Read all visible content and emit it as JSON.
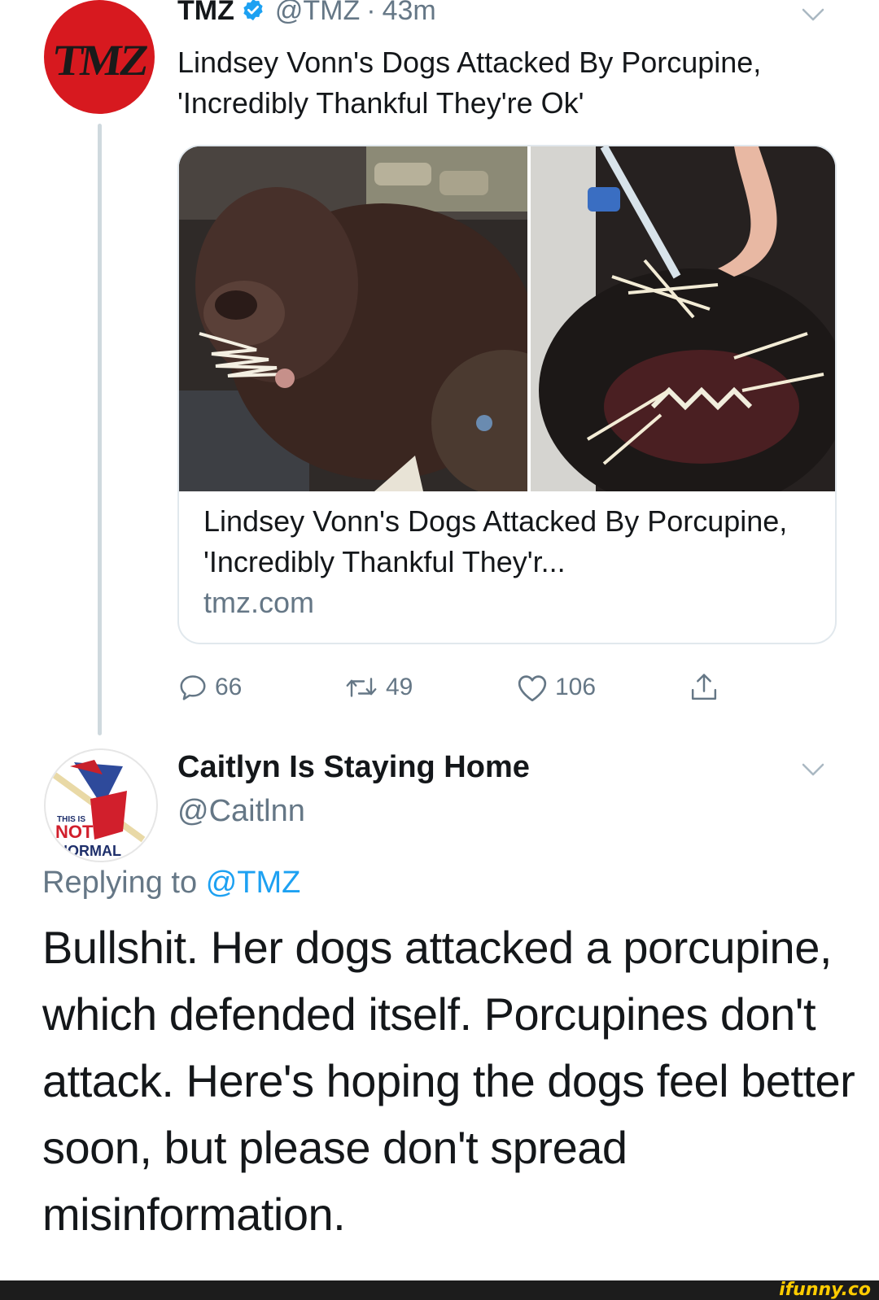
{
  "tweet": {
    "display_name": "TMZ",
    "handle": "@TMZ",
    "separator": "·",
    "time": "43m",
    "avatar_logo": "TMZ",
    "text": "Lindsey Vonn's Dogs Attacked By Porcupine, 'Incredibly Thankful They're Ok'",
    "card": {
      "title": "Lindsey Vonn's Dogs Attacked By Porcupine, 'Incredibly Thankful They'r...",
      "domain": "tmz.com"
    },
    "actions": {
      "replies": "66",
      "retweets": "49",
      "likes": "106"
    }
  },
  "reply": {
    "display_name": "Caitlyn Is Staying Home",
    "handle": "@Caitlnn",
    "replying_prefix": "Replying to",
    "replying_to": "@TMZ",
    "avatar_text_top": "THIS IS",
    "avatar_text_mid": "NOT",
    "avatar_text_bottom": "NORMAL",
    "text": "Bullshit. Her dogs attacked a porcupine, which defended itself. Porcupines don't attack. Here's hoping the dogs feel better soon, but please don't spread misinformation."
  },
  "watermark": "ifunny.co",
  "colors": {
    "accent": "#1da1f2",
    "secondary_text": "#657786",
    "tmz_red": "#d7191f"
  }
}
